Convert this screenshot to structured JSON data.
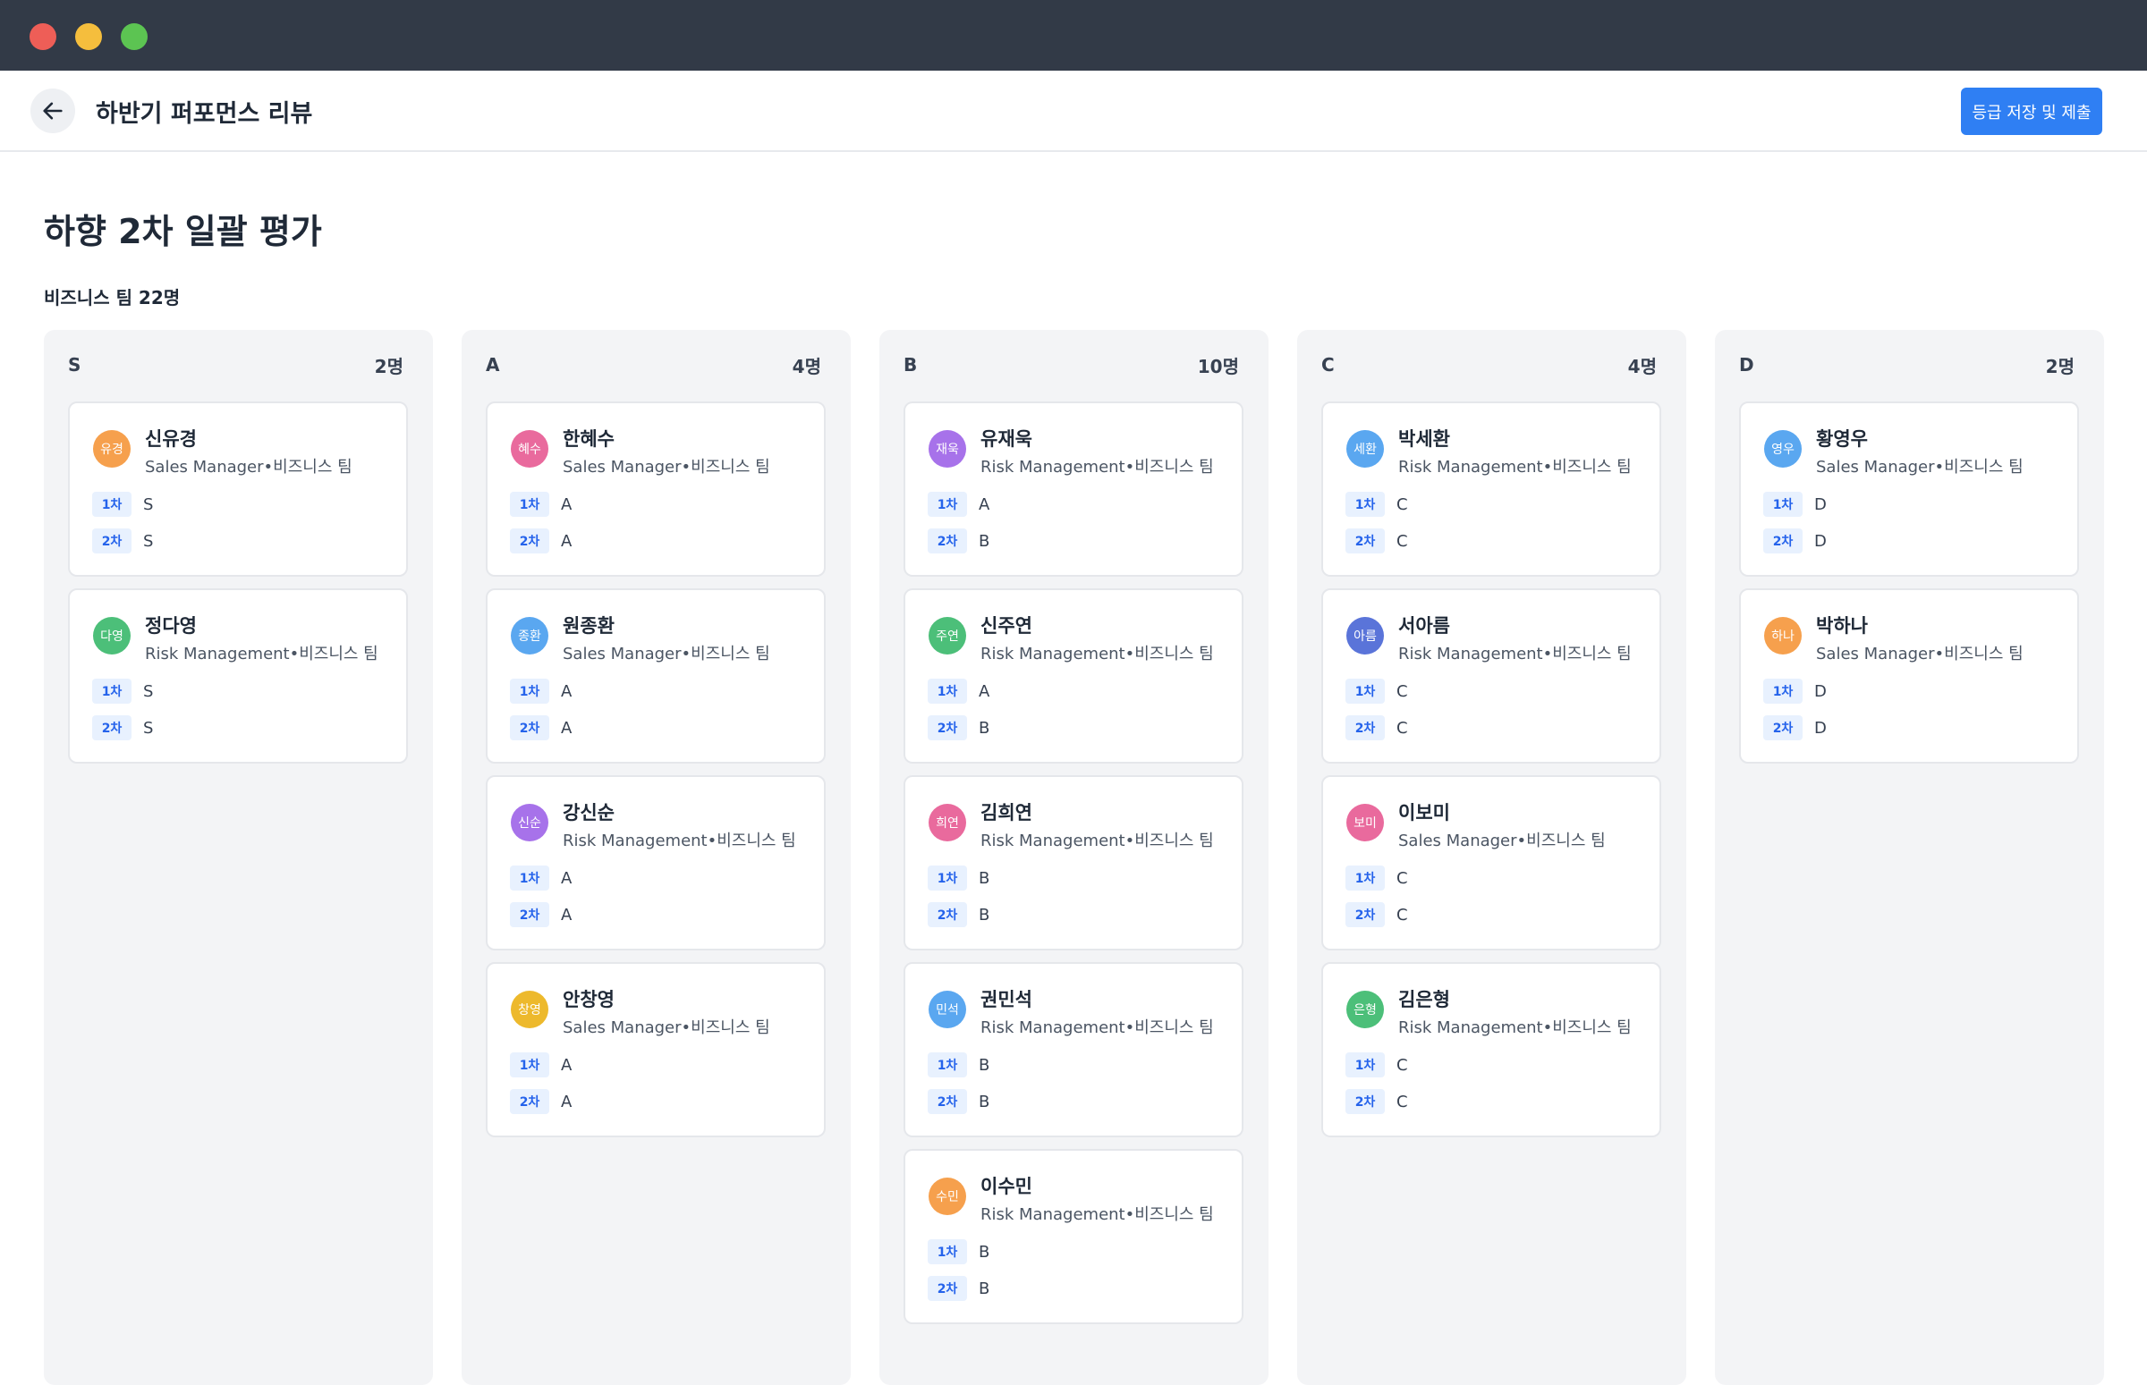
{
  "header": {
    "title": "하반기 퍼포먼스 리뷰",
    "submit_label": "등급 저장 및 제출"
  },
  "page": {
    "title": "하향 2차 일괄 평가",
    "team_count": "비즈니스 팀 22명"
  },
  "round_labels": {
    "first": "1차",
    "second": "2차"
  },
  "colors": {
    "titlebar": "#323a47",
    "accent": "#2f7ff3",
    "column_bg": "#f3f4f6",
    "badge_bg": "#e8f1fe"
  },
  "columns": [
    {
      "grade": "S",
      "count": "2명",
      "cards": [
        {
          "avatar": "유경",
          "color": "#f6a04d",
          "name": "신유경",
          "role": "Sales Manager•비즈니스 팀",
          "first": "S",
          "second": "S"
        },
        {
          "avatar": "다영",
          "color": "#4cbf79",
          "name": "정다영",
          "role": "Risk Management•비즈니스 팀",
          "first": "S",
          "second": "S"
        }
      ]
    },
    {
      "grade": "A",
      "count": "4명",
      "cards": [
        {
          "avatar": "혜수",
          "color": "#e96a9d",
          "name": "한혜수",
          "role": "Sales Manager•비즈니스 팀",
          "first": "A",
          "second": "A"
        },
        {
          "avatar": "종환",
          "color": "#5aa7f0",
          "name": "원종환",
          "role": "Sales Manager•비즈니스 팀",
          "first": "A",
          "second": "A"
        },
        {
          "avatar": "신순",
          "color": "#a772ea",
          "name": "강신순",
          "role": "Risk Management•비즈니스 팀",
          "first": "A",
          "second": "A"
        },
        {
          "avatar": "창영",
          "color": "#edb92c",
          "name": "안창영",
          "role": "Sales Manager•비즈니스 팀",
          "first": "A",
          "second": "A"
        }
      ]
    },
    {
      "grade": "B",
      "count": "10명",
      "cards": [
        {
          "avatar": "재욱",
          "color": "#a772ea",
          "name": "유재욱",
          "role": "Risk Management•비즈니스 팀",
          "first": "A",
          "second": "B"
        },
        {
          "avatar": "주연",
          "color": "#4cbf79",
          "name": "신주연",
          "role": "Risk Management•비즈니스 팀",
          "first": "A",
          "second": "B"
        },
        {
          "avatar": "희연",
          "color": "#e96a9d",
          "name": "김희연",
          "role": "Risk Management•비즈니스 팀",
          "first": "B",
          "second": "B"
        },
        {
          "avatar": "민석",
          "color": "#5aa7f0",
          "name": "권민석",
          "role": "Risk Management•비즈니스 팀",
          "first": "B",
          "second": "B"
        },
        {
          "avatar": "수민",
          "color": "#f6a04d",
          "name": "이수민",
          "role": "Risk Management•비즈니스 팀",
          "first": "B",
          "second": "B"
        }
      ]
    },
    {
      "grade": "C",
      "count": "4명",
      "cards": [
        {
          "avatar": "세환",
          "color": "#5aa7f0",
          "name": "박세환",
          "role": "Risk Management•비즈니스 팀",
          "first": "C",
          "second": "C"
        },
        {
          "avatar": "아름",
          "color": "#5a74d9",
          "name": "서아름",
          "role": "Risk Management•비즈니스 팀",
          "first": "C",
          "second": "C"
        },
        {
          "avatar": "보미",
          "color": "#e96a9d",
          "name": "이보미",
          "role": "Sales Manager•비즈니스 팀",
          "first": "C",
          "second": "C"
        },
        {
          "avatar": "은형",
          "color": "#4cbf79",
          "name": "김은형",
          "role": "Risk Management•비즈니스 팀",
          "first": "C",
          "second": "C"
        }
      ]
    },
    {
      "grade": "D",
      "count": "2명",
      "cards": [
        {
          "avatar": "영우",
          "color": "#5aa7f0",
          "name": "황영우",
          "role": "Sales Manager•비즈니스 팀",
          "first": "D",
          "second": "D"
        },
        {
          "avatar": "하나",
          "color": "#f6a04d",
          "name": "박하나",
          "role": "Sales Manager•비즈니스 팀",
          "first": "D",
          "second": "D"
        }
      ]
    }
  ]
}
